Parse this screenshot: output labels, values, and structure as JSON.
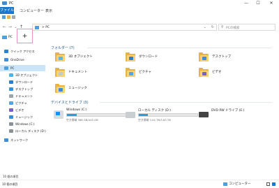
{
  "window": {
    "title": "PC",
    "controls": {
      "minimize": "—",
      "maximize": "☐",
      "close": "✕"
    }
  },
  "ribbon": {
    "tabs": [
      "ファイル",
      "コンピューター",
      "表示"
    ]
  },
  "nav": {
    "back": "←",
    "forward": "→",
    "recent": "⌄",
    "up": "↑",
    "breadcrumb": "> PC",
    "dropdown": "⌄",
    "refresh": "↻"
  },
  "search": {
    "placeholder": "PCの検索",
    "icon": "search-icon"
  },
  "tabs": [
    {
      "label": "PC"
    }
  ],
  "new_tab_label": "+",
  "sidebar": {
    "items": [
      {
        "label": "クイック アクセス",
        "icon": "star-icon",
        "color": "#2a82d6"
      },
      {
        "label": "OneDrive",
        "icon": "cloud-icon",
        "color": "#3a8fde"
      },
      {
        "label": "PC",
        "icon": "pc-icon",
        "color": "#4aa0e0",
        "selected": true
      },
      {
        "label": "3D オブジェクト",
        "icon": "cube-icon",
        "color": "#4bb3e8"
      },
      {
        "label": "ダウンロード",
        "icon": "download-icon",
        "color": "#2a7fd4"
      },
      {
        "label": "デスクトップ",
        "icon": "desktop-icon",
        "color": "#3592df"
      },
      {
        "label": "ドキュメント",
        "icon": "document-icon",
        "color": "#9aa4ae"
      },
      {
        "label": "ピクチャ",
        "icon": "picture-icon",
        "color": "#57a3e3"
      },
      {
        "label": "ビデオ",
        "icon": "video-icon",
        "color": "#7a60c8"
      },
      {
        "label": "ミュージック",
        "icon": "music-icon",
        "color": "#3b8ed6"
      },
      {
        "label": "Windows (C:)",
        "icon": "drive-icon",
        "color": "#8a9096"
      },
      {
        "label": "ローカル ディスク (D:)",
        "icon": "drive-icon",
        "color": "#8a9096"
      },
      {
        "label": "ネットワーク",
        "icon": "network-icon",
        "color": "#3a8fde"
      }
    ],
    "footer_count": "10 個の項目"
  },
  "main": {
    "folders_title": "フォルダー (7)",
    "folders": [
      {
        "label": "3D オブジェクト",
        "icon": "cube-icon",
        "badge": "#5ab7ea"
      },
      {
        "label": "ダウンロード",
        "icon": "download-icon",
        "badge": "#2a7fd4"
      },
      {
        "label": "デスクトップ",
        "icon": "desktop-icon",
        "badge": "#3592df"
      },
      {
        "label": "ドキュメント",
        "icon": "document-icon",
        "badge": "#c4c9ce"
      },
      {
        "label": "ピクチャ",
        "icon": "picture-icon",
        "badge": "#57a3e3"
      },
      {
        "label": "ビデオ",
        "icon": "video-icon",
        "badge": "#7a60c8"
      },
      {
        "label": "ミュージック",
        "icon": "music-icon",
        "badge": "#3b8ed6"
      }
    ],
    "drives_title": "デバイスとドライブ (3)",
    "drives": [
      {
        "name": "Windows (C:)",
        "space": "空き領域 368 GB/445 GB",
        "used_fraction": 0.17,
        "icon": "windows-drive-icon"
      },
      {
        "name": "ローカル ディスク (D:)",
        "space": "空き領域 3.04 TB/3.63 TB",
        "used_fraction": 0.16,
        "icon": "drive-icon"
      },
      {
        "name": "DVD RW ドライブ (E:)",
        "icon": "dvd-drive-icon"
      }
    ]
  },
  "statusbar": {
    "count": "10 個の項目",
    "hint": "コンピューター"
  },
  "colors": {
    "accent": "#1979ca",
    "selection": "#cce4f7",
    "bar_fill": "#26a0da",
    "section_title": "#1b4f8c",
    "new_tab_border": "#ec8fc4"
  }
}
